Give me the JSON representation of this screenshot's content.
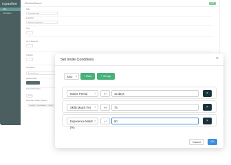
{
  "app": {
    "brand": "rcpastine",
    "sidebar_items": [
      "Jobs",
      "Candidates"
    ]
  },
  "page": {
    "back_title": "‹ Redirect Branch",
    "save_label": "SAVE",
    "fields": [
      {
        "label": "Name",
        "value": "Screening stage"
      },
      {
        "label": "Description",
        "value": "Routing for applicants"
      },
      {
        "label": "Type",
        "value": ""
      },
      {
        "label": "Go To Sequence",
        "value": ""
      },
      {
        "label": "Condition",
        "value": ""
      },
      {
        "label": "Next Branch",
        "value": "Existing Branch"
      },
      {
        "label": "Fallback Action",
        "value": ""
      },
      {
        "label": "Contact Placeholder",
        "value": "Waiting"
      },
      {
        "label": "Placeholder Details (Optional)",
        "value": ""
      }
    ],
    "chips": [
      "Candidate",
      "Email Address",
      "Phone"
    ]
  },
  "modal": {
    "title": "Set Invite Conditions",
    "logic_operator": "AND",
    "add_rule_label": "+ Rule",
    "add_group_label": "+ Group",
    "conditions": [
      {
        "field": "Notice Period",
        "operator": "<",
        "value": "15 days"
      },
      {
        "field": "Skills Match (%)",
        "operator": ">=",
        "value": "75"
      },
      {
        "field": "Experience Match (%)",
        "operator": "=",
        "value": "80"
      }
    ],
    "cancel_label": "Cancel",
    "ok_label": "OK"
  },
  "icons": {
    "close": "close-icon",
    "delete": "close-icon",
    "dropdown": "chevron-down-icon"
  },
  "colors": {
    "sidebar": "#0f2a2b",
    "accent_green": "#46b27a",
    "ok_blue": "#3d8fe0",
    "delete_dark": "#18323a"
  }
}
